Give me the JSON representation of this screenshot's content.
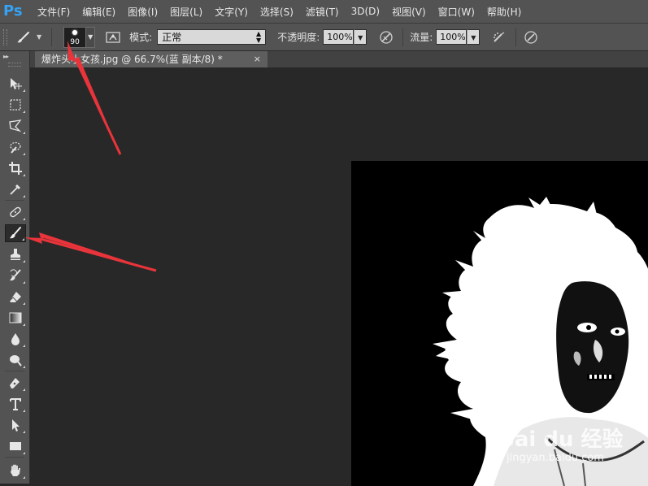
{
  "app": {
    "logo": "Ps"
  },
  "menu": [
    {
      "label": "文件(F)"
    },
    {
      "label": "编辑(E)"
    },
    {
      "label": "图像(I)"
    },
    {
      "label": "图层(L)"
    },
    {
      "label": "文字(Y)"
    },
    {
      "label": "选择(S)"
    },
    {
      "label": "滤镜(T)"
    },
    {
      "label": "3D(D)"
    },
    {
      "label": "视图(V)"
    },
    {
      "label": "窗口(W)"
    },
    {
      "label": "帮助(H)"
    }
  ],
  "options": {
    "brush_size": "90",
    "mode_label": "模式:",
    "mode_value": "正常",
    "opacity_label": "不透明度:",
    "opacity_value": "100%",
    "flow_label": "流量:",
    "flow_value": "100%"
  },
  "document": {
    "tab_title": "爆炸头小女孩.jpg @ 66.7%(蓝 副本/8) *",
    "close_glyph": "×"
  },
  "watermark": {
    "main": "Bai du 经验",
    "sub": "jingyan.baidu.com"
  },
  "colors": {
    "accent": "#35a3f5",
    "arrow": "#e8343a",
    "panel": "#535353",
    "workspace": "#282828"
  },
  "icons": {
    "tools": [
      "move-icon",
      "marquee-icon",
      "lasso-icon",
      "quick-select-icon",
      "crop-icon",
      "eyedropper-icon",
      "healing-brush-icon",
      "brush-icon",
      "clone-stamp-icon",
      "history-brush-icon",
      "eraser-icon",
      "gradient-icon",
      "blur-icon",
      "dodge-icon",
      "pen-icon",
      "type-icon",
      "path-select-icon",
      "rectangle-icon",
      "hand-icon"
    ]
  }
}
